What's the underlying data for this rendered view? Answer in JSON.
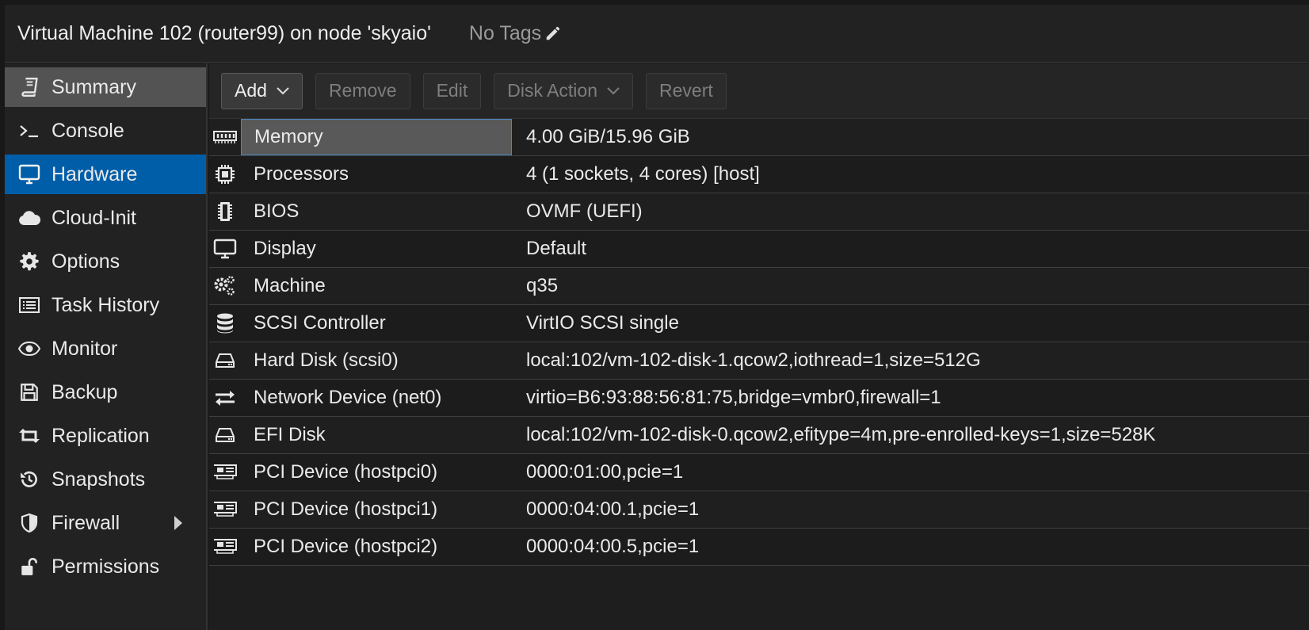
{
  "header": {
    "title": "Virtual Machine 102 (router99) on node 'skyaio'",
    "tags_label": "No Tags"
  },
  "sidebar": {
    "items": [
      {
        "label": "Summary",
        "icon": "book-icon"
      },
      {
        "label": "Console",
        "icon": "terminal-icon"
      },
      {
        "label": "Hardware",
        "icon": "desktop-icon"
      },
      {
        "label": "Cloud-Init",
        "icon": "cloud-icon"
      },
      {
        "label": "Options",
        "icon": "gear-icon"
      },
      {
        "label": "Task History",
        "icon": "list-icon"
      },
      {
        "label": "Monitor",
        "icon": "eye-icon"
      },
      {
        "label": "Backup",
        "icon": "floppy-icon"
      },
      {
        "label": "Replication",
        "icon": "retweet-icon"
      },
      {
        "label": "Snapshots",
        "icon": "history-icon"
      },
      {
        "label": "Firewall",
        "icon": "shield-icon"
      },
      {
        "label": "Permissions",
        "icon": "unlock-icon"
      }
    ],
    "active": "Hardware"
  },
  "toolbar": {
    "add_label": "Add",
    "remove_label": "Remove",
    "edit_label": "Edit",
    "disk_action_label": "Disk Action",
    "revert_label": "Revert"
  },
  "hardware": {
    "rows": [
      {
        "name": "Memory",
        "value": "4.00 GiB/15.96 GiB",
        "icon": "memory-icon"
      },
      {
        "name": "Processors",
        "value": "4 (1 sockets, 4 cores) [host]",
        "icon": "cpu-icon"
      },
      {
        "name": "BIOS",
        "value": "OVMF (UEFI)",
        "icon": "microchip-icon"
      },
      {
        "name": "Display",
        "value": "Default",
        "icon": "desktop-icon"
      },
      {
        "name": "Machine",
        "value": "q35",
        "icon": "cogs-icon"
      },
      {
        "name": "SCSI Controller",
        "value": "VirtIO SCSI single",
        "icon": "database-icon"
      },
      {
        "name": "Hard Disk (scsi0)",
        "value": "local:102/vm-102-disk-1.qcow2,iothread=1,size=512G",
        "icon": "hdd-icon"
      },
      {
        "name": "Network Device (net0)",
        "value": "virtio=B6:93:88:56:81:75,bridge=vmbr0,firewall=1",
        "icon": "exchange-icon"
      },
      {
        "name": "EFI Disk",
        "value": "local:102/vm-102-disk-0.qcow2,efitype=4m,pre-enrolled-keys=1,size=528K",
        "icon": "hdd-icon"
      },
      {
        "name": "PCI Device (hostpci0)",
        "value": "0000:01:00,pcie=1",
        "icon": "pci-card-icon"
      },
      {
        "name": "PCI Device (hostpci1)",
        "value": "0000:04:00.1,pcie=1",
        "icon": "pci-card-icon"
      },
      {
        "name": "PCI Device (hostpci2)",
        "value": "0000:04:00.5,pcie=1",
        "icon": "pci-card-icon"
      }
    ]
  },
  "colors": {
    "active_nav": "#005ea9",
    "summary_nav": "#535353",
    "background": "#1e1e1e",
    "selection_border": "#4a86c0"
  }
}
